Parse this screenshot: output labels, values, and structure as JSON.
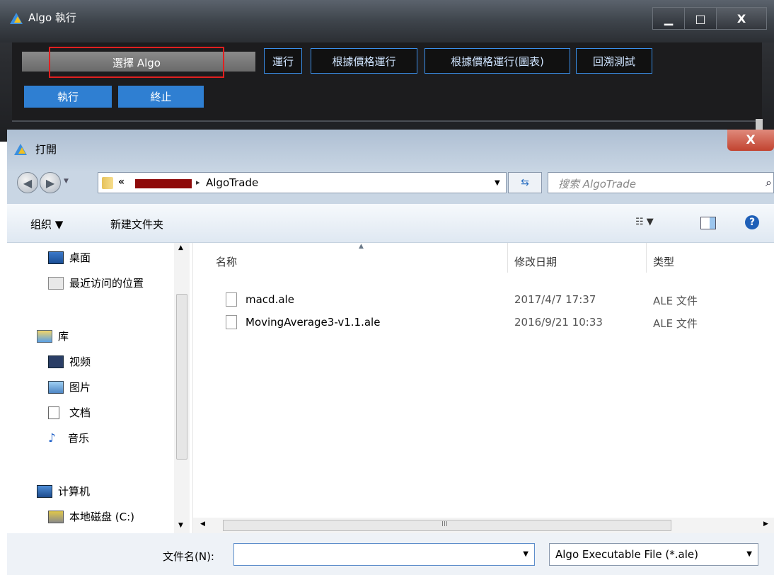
{
  "algo_window": {
    "title": "Algo 執行",
    "select_algo_label": "選擇 Algo",
    "buttons": [
      "運行",
      "根據價格運行",
      "根據價格運行(圖表)",
      "回溯測試"
    ],
    "execute_label": "執行",
    "stop_label": "終止",
    "minimize": "▁",
    "maximize": "□",
    "close": "X"
  },
  "dialog": {
    "title": "打開",
    "close": "X",
    "address": {
      "prefix": "«",
      "arrow": "▸",
      "current": "AlgoTrade",
      "dropdown": "▼"
    },
    "search_placeholder": "搜索 AlgoTrade",
    "toolbar": {
      "organize": "组织 ▼",
      "new_folder": "新建文件夹",
      "view": "☷ ▼",
      "help": "?"
    },
    "nav": [
      {
        "label": "桌面"
      },
      {
        "label": "最近访问的位置"
      },
      {
        "label": "库"
      },
      {
        "label": "视频"
      },
      {
        "label": "图片"
      },
      {
        "label": "文档"
      },
      {
        "label": "音乐"
      },
      {
        "label": "计算机"
      },
      {
        "label": "本地磁盘 (C:)"
      }
    ],
    "columns": {
      "name": "名称",
      "modified": "修改日期",
      "type": "类型"
    },
    "files": [
      {
        "name": "macd.ale",
        "modified": "2017/4/7 17:37",
        "type": "ALE 文件"
      },
      {
        "name": "MovingAverage3-v1.1.ale",
        "modified": "2016/9/21 10:33",
        "type": "ALE 文件"
      }
    ],
    "filename_label": "文件名(N):",
    "filename_value": "",
    "filetype": "Algo Executable File (*.ale)"
  },
  "colors": {
    "accent": "#2f7fd2",
    "highlight": "#e02020",
    "folder": "#e6c25a"
  }
}
